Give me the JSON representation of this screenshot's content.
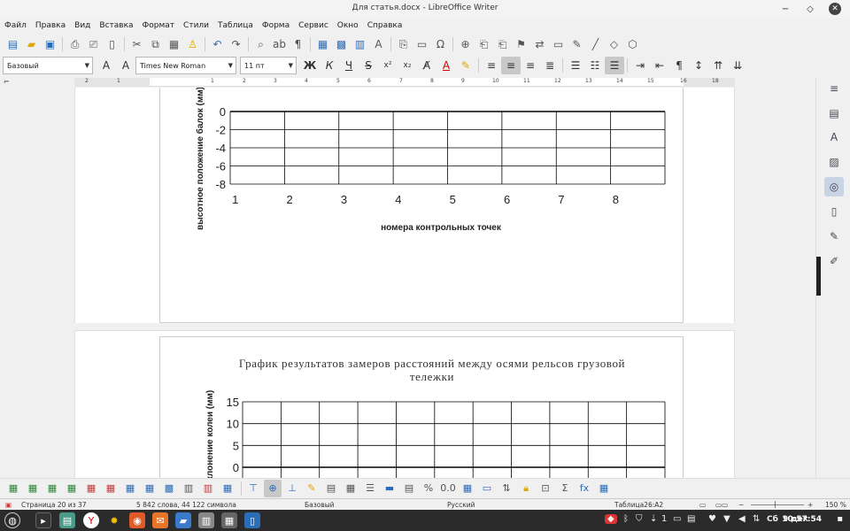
{
  "window": {
    "title": "Для статья.docx - LibreOffice Writer"
  },
  "menu": [
    "Файл",
    "Правка",
    "Вид",
    "Вставка",
    "Формат",
    "Стили",
    "Таблица",
    "Форма",
    "Сервис",
    "Окно",
    "Справка"
  ],
  "formatting": {
    "paragraph_style": "Базовый",
    "font_name": "Times New Roman",
    "font_size": "11 пт",
    "bold": "Ж",
    "italic": "К",
    "underline": "Ч",
    "strike": "S"
  },
  "ruler": {
    "numbers": [
      "2",
      "1",
      "1",
      "2",
      "3",
      "4",
      "5",
      "6",
      "7",
      "8",
      "9",
      "10",
      "11",
      "12",
      "13",
      "14",
      "15",
      "16",
      "18"
    ]
  },
  "chart_data": [
    {
      "type": "line",
      "title": "",
      "ylabel": "высотное положение балок (мм)",
      "xlabel": "номера  контрольных точек",
      "y_ticks": [
        "0",
        "-2",
        "-4",
        "-6",
        "-8"
      ],
      "ylim": [
        -8,
        0
      ],
      "x_ticks": [
        "1",
        "2",
        "3",
        "4",
        "5",
        "6",
        "7",
        "8"
      ],
      "grid": true,
      "series": []
    },
    {
      "type": "line",
      "title": "График результатов замеров расстояний между осями рельсов грузовой тележки",
      "ylabel": "клонение колеи (мм)",
      "y_ticks": [
        "15",
        "10",
        "5",
        "0"
      ],
      "ylim": [
        0,
        15
      ],
      "grid": true,
      "series": []
    }
  ],
  "status": {
    "page": "Страница 20 из 37",
    "words": "5 842 слова, 44 122 символа",
    "style": "Базовый",
    "language": "Русский",
    "cell": "Таблица26:A2",
    "zoom": "150 %"
  },
  "taskbar": {
    "keyboard": "1",
    "day": "Сб",
    "date": "9 дек",
    "time": "10:57:54"
  }
}
